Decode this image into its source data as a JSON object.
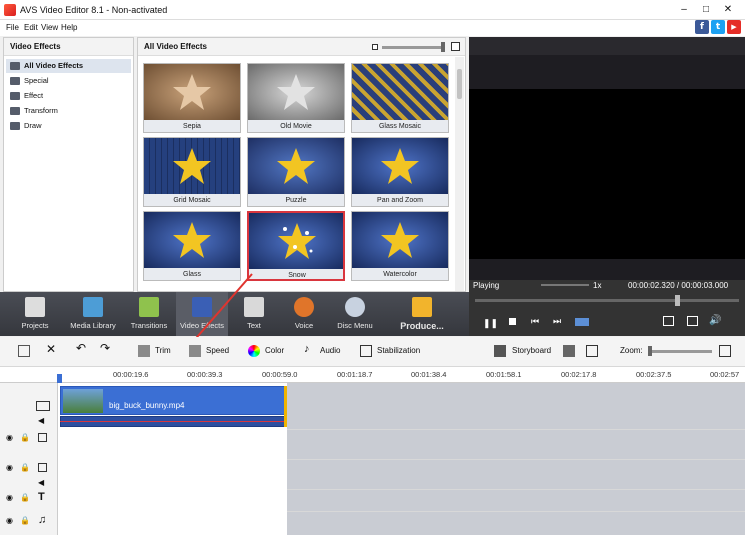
{
  "window": {
    "title": "AVS Video Editor 8.1 - Non-activated"
  },
  "menu": [
    "File",
    "Edit",
    "View",
    "Help"
  ],
  "social": [
    {
      "name": "facebook-icon",
      "glyph": "f",
      "color": "#3b5998"
    },
    {
      "name": "twitter-icon",
      "glyph": "t",
      "color": "#1da1f2"
    },
    {
      "name": "youtube-icon",
      "glyph": "▶",
      "color": "#e52d27"
    }
  ],
  "left_panel": {
    "header": "Video Effects",
    "items": [
      "All Video Effects",
      "Special",
      "Effect",
      "Transform",
      "Draw"
    ]
  },
  "effects": {
    "header": "All Video Effects",
    "tiles": [
      "Sepia",
      "Old Movie",
      "Glass Mosaic",
      "Grid Mosaic",
      "Puzzle",
      "Pan and Zoom",
      "Glass",
      "Snow",
      "Watercolor"
    ]
  },
  "player": {
    "status": "Playing",
    "speed": "1x",
    "time": "00:00:02.320 / 00:00:03.000"
  },
  "toolbar": {
    "items": [
      "Projects",
      "Media Library",
      "Transitions",
      "Video Effects",
      "Text",
      "Voice",
      "Disc Menu",
      "Produce..."
    ]
  },
  "edit_toolbar": {
    "trim": "Trim",
    "speed": "Speed",
    "color": "Color",
    "audio": "Audio",
    "stabilization": "Stabilization",
    "storyboard": "Storyboard",
    "zoom": "Zoom:"
  },
  "ruler": [
    "00:00:19.6",
    "00:00:39.3",
    "00:00:59.0",
    "00:01:18.7",
    "00:01:38.4",
    "00:01:58.1",
    "00:02:17.8",
    "00:02:37.5",
    "00:02:57"
  ],
  "clip": {
    "name": "big_buck_bunny.mp4"
  },
  "colors": {
    "toolbar": "#3e4148",
    "clip": "#3b6fd4",
    "highlight": "#d9363e",
    "arrow": "#e0342e"
  }
}
